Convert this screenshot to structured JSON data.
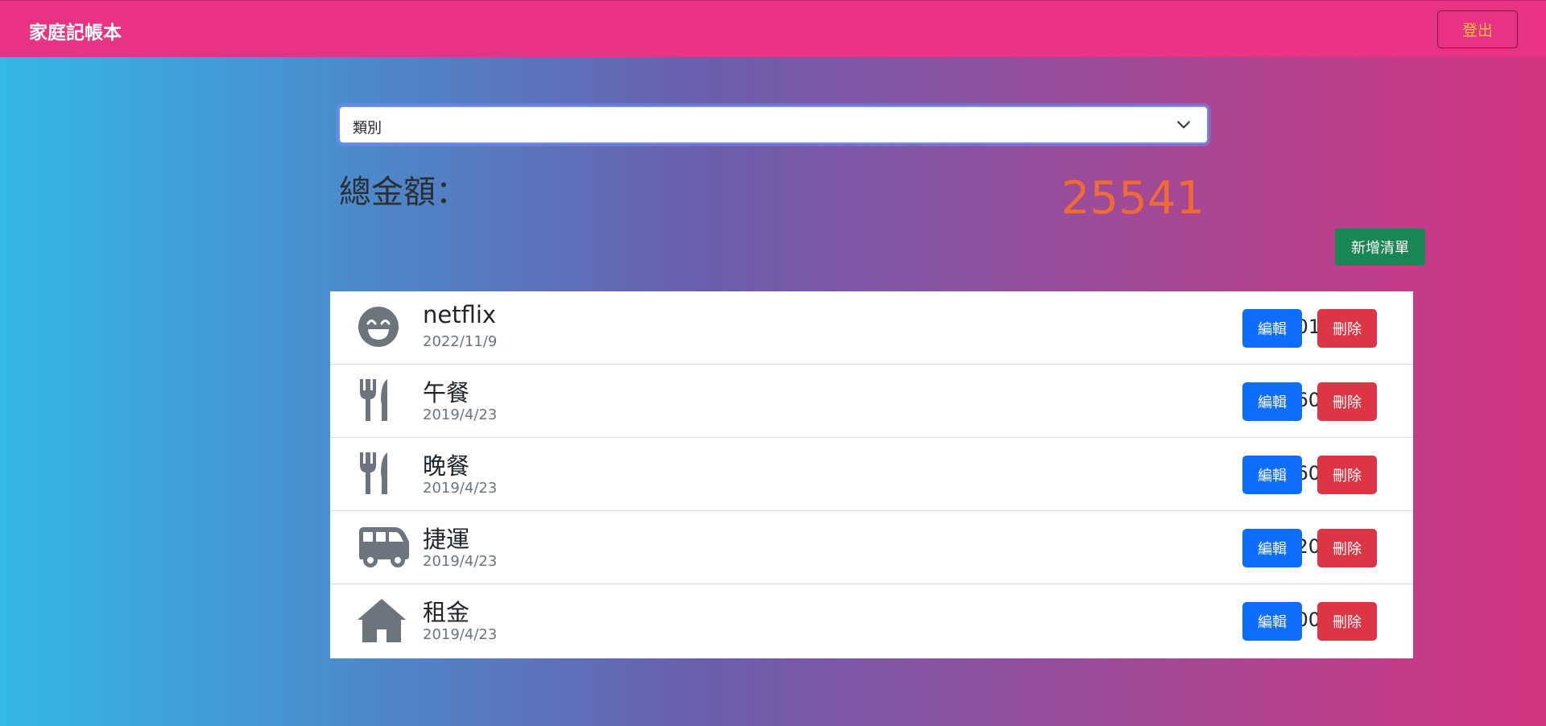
{
  "header": {
    "brand": "家庭記帳本",
    "logout_label": "登出"
  },
  "filter": {
    "selected": "類別",
    "chevron_icon": "chevron-down-icon"
  },
  "summary": {
    "total_label": "總金額：",
    "total_value": "25541"
  },
  "add_button_label": "新增清單",
  "items": [
    {
      "icon": "smile-icon",
      "name": "netflix",
      "date": "2022/11/9",
      "amount": "301",
      "edit_label": "編輯",
      "delete_label": "刪除"
    },
    {
      "icon": "utensils-icon",
      "name": "午餐",
      "date": "2019/4/23",
      "amount": "60",
      "edit_label": "編輯",
      "delete_label": "刪除"
    },
    {
      "icon": "utensils-icon",
      "name": "晚餐",
      "date": "2019/4/23",
      "amount": "60",
      "edit_label": "編輯",
      "delete_label": "刪除"
    },
    {
      "icon": "bus-icon",
      "name": "捷運",
      "date": "2019/4/23",
      "amount": "120",
      "edit_label": "編輯",
      "delete_label": "刪除"
    },
    {
      "icon": "home-icon",
      "name": "租金",
      "date": "2019/4/23",
      "amount": "25000",
      "edit_label": "編輯",
      "delete_label": "刪除"
    }
  ],
  "colors": {
    "navbar": "#e83283",
    "total_value": "#f06a35",
    "add_button": "#198754",
    "edit_button": "#0d6efd",
    "delete_button": "#dc3545",
    "icon": "#6c757d"
  }
}
